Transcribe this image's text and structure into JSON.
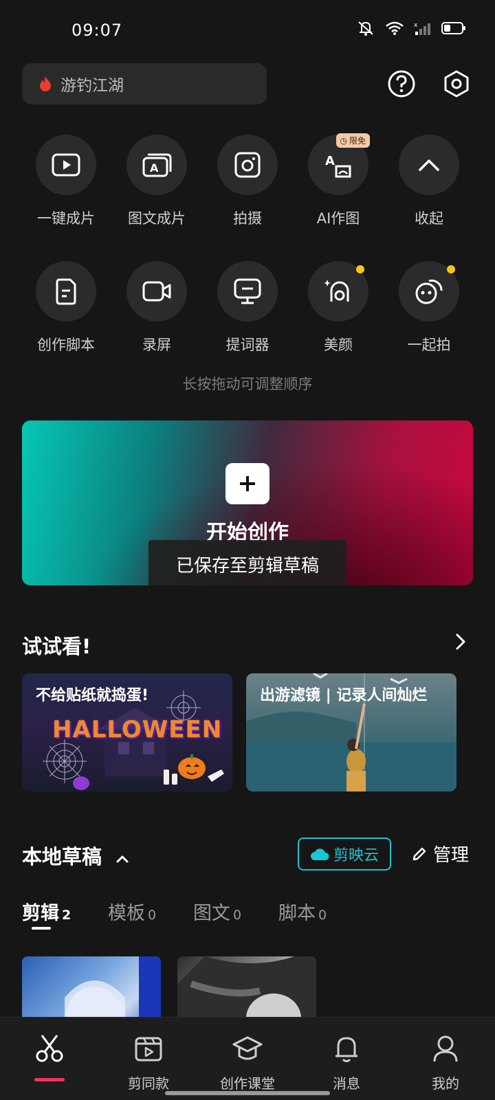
{
  "status_bar": {
    "time": "09:07"
  },
  "search": {
    "text": "游钓江湖"
  },
  "tools": [
    {
      "label": "一键成片",
      "icon": "play-video-icon"
    },
    {
      "label": "图文成片",
      "icon": "text-to-video-icon"
    },
    {
      "label": "拍摄",
      "icon": "camera-icon"
    },
    {
      "label": "AI作图",
      "icon": "ai-image-icon",
      "badge": "限免"
    },
    {
      "label": "收起",
      "icon": "chevron-up-icon"
    },
    {
      "label": "创作脚本",
      "icon": "script-icon"
    },
    {
      "label": "录屏",
      "icon": "screen-record-icon"
    },
    {
      "label": "提词器",
      "icon": "teleprompter-icon"
    },
    {
      "label": "美颜",
      "icon": "beauty-icon"
    },
    {
      "label": "一起拍",
      "icon": "shoot-together-icon"
    }
  ],
  "tools_hint": "长按拖动可调整顺序",
  "create": {
    "title": "开始创作",
    "toast": "已保存至剪辑草稿"
  },
  "try_section": {
    "title": "试试看!",
    "cards": [
      {
        "title": "不给贴纸就捣蛋!",
        "art_text": "HALLOWEEN"
      },
      {
        "title": "出游滤镜 | 记录人间灿烂"
      }
    ]
  },
  "drafts": {
    "title": "本地草稿",
    "cloud_label": "剪映云",
    "manage_label": "管理",
    "tabs": [
      {
        "label": "剪辑",
        "count": "2"
      },
      {
        "label": "模板",
        "count": "0"
      },
      {
        "label": "图文",
        "count": "0"
      },
      {
        "label": "脚本",
        "count": "0"
      }
    ]
  },
  "bottom_nav": [
    {
      "label": "",
      "icon": "scissors-icon"
    },
    {
      "label": "剪同款",
      "icon": "template-icon"
    },
    {
      "label": "创作课堂",
      "icon": "graduation-cap-icon"
    },
    {
      "label": "消息",
      "icon": "bell-icon"
    },
    {
      "label": "我的",
      "icon": "user-icon"
    }
  ],
  "colors": {
    "background": "#161616",
    "accent_cyan": "#16c7d8",
    "accent_red": "#f0365a",
    "badge_dot": "#f5c518"
  }
}
